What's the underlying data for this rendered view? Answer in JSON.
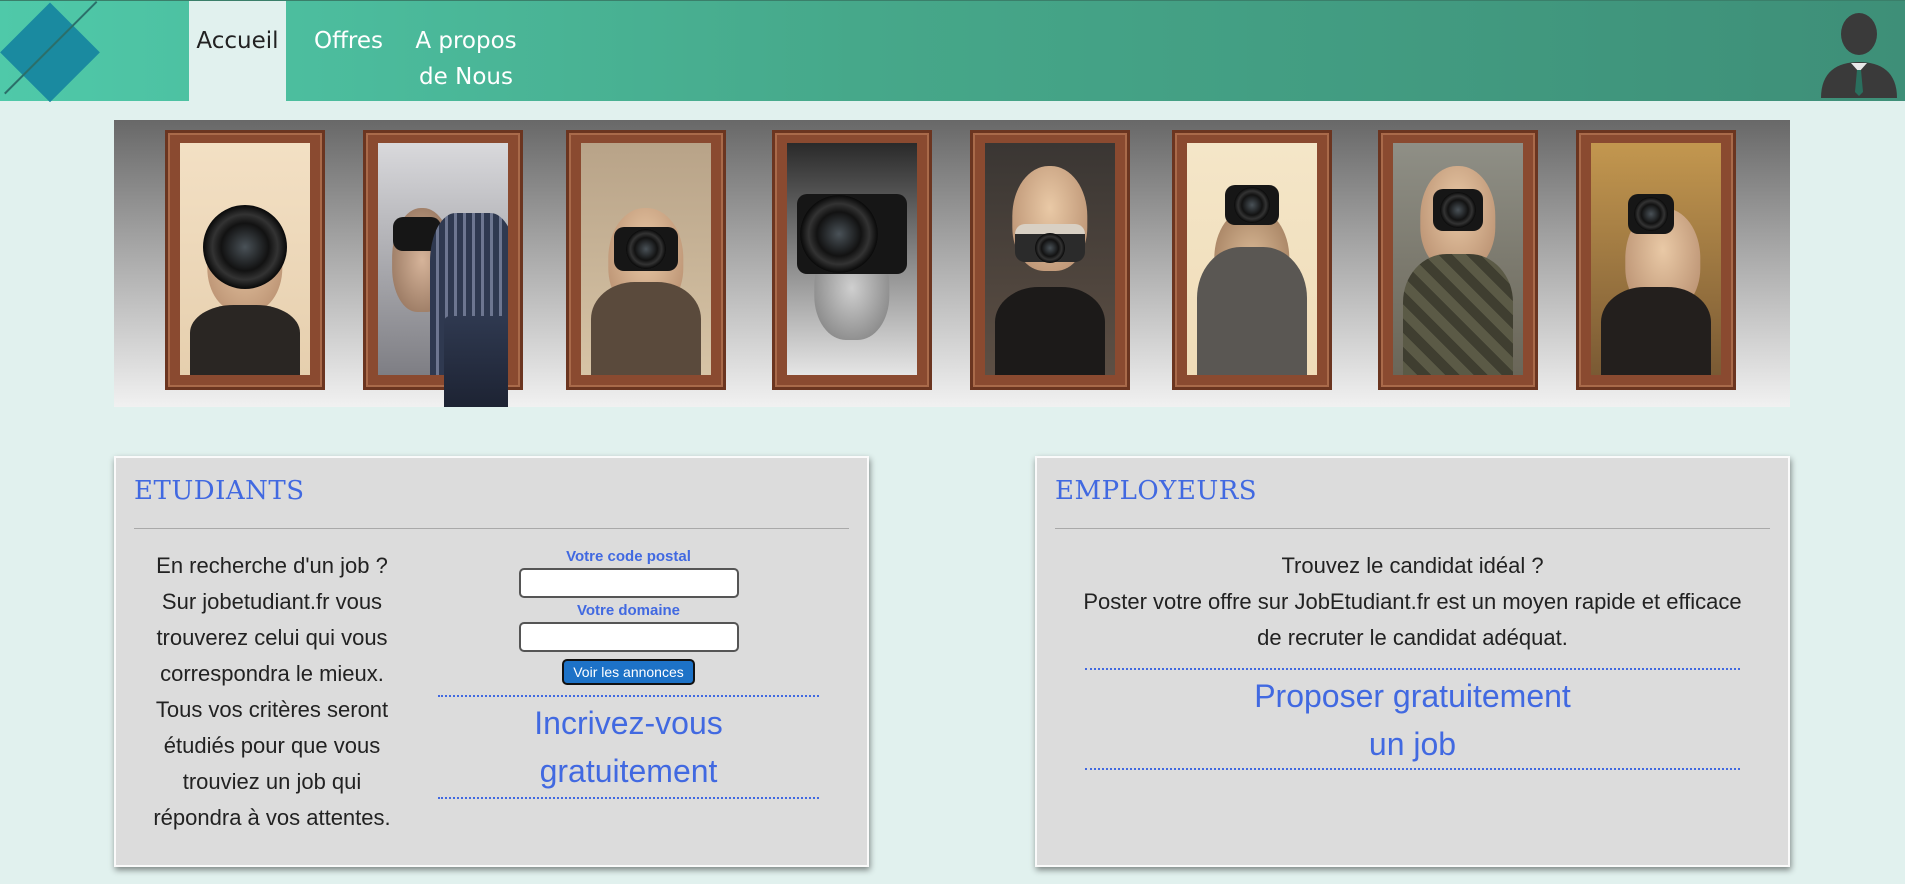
{
  "nav": {
    "items": [
      {
        "label": "Accueil",
        "active": true
      },
      {
        "label": "Offres",
        "active": false
      },
      {
        "label_line1": "A propos",
        "label_line2": "de Nous",
        "active": false
      }
    ]
  },
  "icons": {
    "logo": "logo-diamond-icon",
    "avatar": "user-avatar-icon"
  },
  "banner": {
    "photos": [
      "photographer-1",
      "photographer-2",
      "photographer-3",
      "photographer-4",
      "photographer-5",
      "photographer-6",
      "photographer-7",
      "photographer-8"
    ]
  },
  "students": {
    "title": "ETUDIANTS",
    "description_lines": [
      "En recherche d'un job ?",
      "Sur jobetudiant.fr vous",
      "trouverez celui qui vous",
      "correspondra le mieux.",
      "Tous vos critères seront",
      "étudiés pour que vous",
      "trouviez un job qui",
      "répondra à vos attentes."
    ],
    "postal_label": "Votre code postal",
    "postal_value": "",
    "domain_label": "Votre domaine",
    "domain_value": "",
    "search_button": "Voir les annonces",
    "signup_line1": "Incrivez-vous",
    "signup_line2": "gratuitement"
  },
  "employers": {
    "title": "EMPLOYEURS",
    "description_line1": "Trouvez le candidat idéal ?",
    "description_line2": "Poster votre offre sur JobEtudiant.fr est un moyen rapide et efficace",
    "description_line3": "de recruter le candidat adéquat.",
    "cta_line1": "Proposer gratuitement",
    "cta_line2": "un job"
  },
  "colors": {
    "header_start": "#4fc9a9",
    "header_end": "#3e8f78",
    "page_bg": "#e1f1ee",
    "accent": "#4169e1",
    "button": "#1d72c7"
  }
}
